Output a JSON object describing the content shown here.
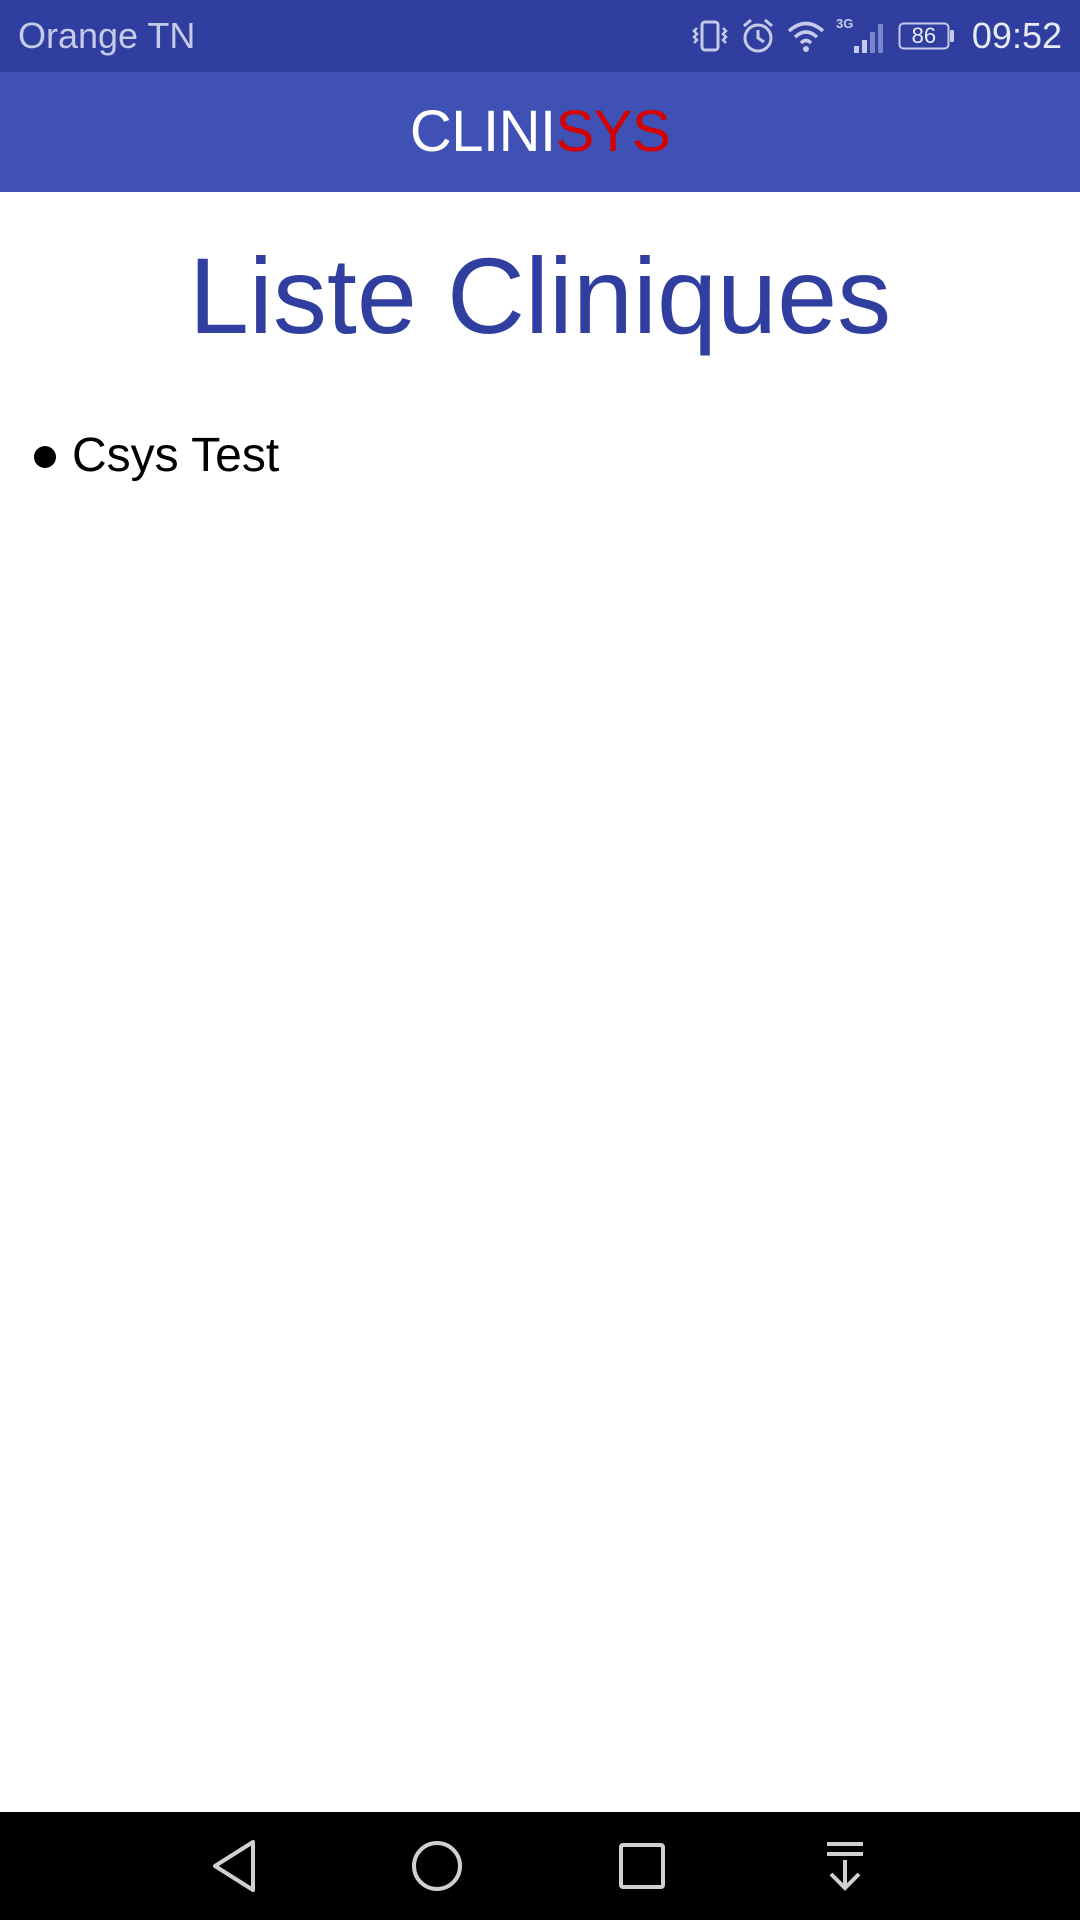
{
  "status_bar": {
    "carrier": "Orange TN",
    "network_type": "3G",
    "battery_level": "86",
    "time": "09:52",
    "icons": [
      "vibrate-icon",
      "alarm-icon",
      "wifi-icon",
      "signal-icon",
      "battery-icon"
    ]
  },
  "app_bar": {
    "brand_part1": "CLINI",
    "brand_part2": "SYS",
    "colors": {
      "background": "#3F51B5",
      "brand_part1": "#FFFFFF",
      "brand_part2": "#D50000"
    }
  },
  "main": {
    "title": "Liste Cliniques",
    "title_color": "#303F9F",
    "clinics": [
      {
        "name": "Csys Test"
      }
    ]
  },
  "nav_bar": {
    "buttons": [
      "back-icon",
      "home-icon",
      "recents-icon",
      "notification-pull-icon"
    ]
  }
}
